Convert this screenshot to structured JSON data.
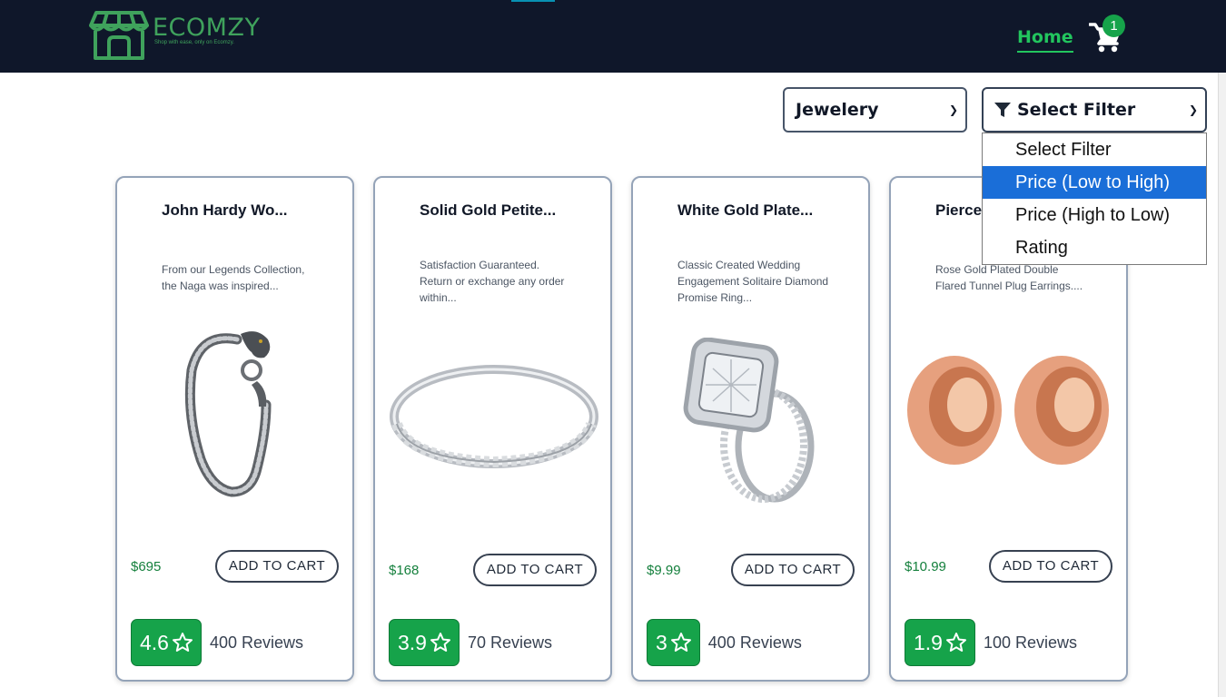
{
  "brand": {
    "name": "ECOMZY",
    "tagline": "Shop with ease, only on Ecomzy."
  },
  "nav": {
    "home_label": "Home",
    "cart_count": "1"
  },
  "filters": {
    "category_value": "Jewelery",
    "sort_value": "Select Filter",
    "sort_options": [
      "Select Filter",
      "Price (Low to High)",
      "Price (High to Low)",
      "Rating"
    ],
    "highlighted_option": "Price (Low to High)"
  },
  "products": [
    {
      "title": "John Hardy Wo...",
      "description": "From our Legends Collection, the Naga was inspired...",
      "image": "chain-bracelet",
      "price": "$695",
      "add_label": "ADD TO CART",
      "rating": "4.6",
      "reviews": "400 Reviews"
    },
    {
      "title": "Solid Gold Petite...",
      "description": "Satisfaction Guaranteed. Return or exchange any order within...",
      "image": "eternity-ring",
      "price": "$168",
      "add_label": "ADD TO CART",
      "rating": "3.9",
      "reviews": "70 Reviews"
    },
    {
      "title": "White Gold Plate...",
      "description": "Classic Created Wedding Engagement Solitaire Diamond Promise Ring...",
      "image": "halo-ring-set",
      "price": "$9.99",
      "add_label": "ADD TO CART",
      "rating": "3",
      "reviews": "400 Reviews"
    },
    {
      "title": "Pierced Owl Ros...",
      "description": "Rose Gold Plated Double Flared Tunnel Plug Earrings....",
      "image": "tunnel-plugs",
      "price": "$10.99",
      "add_label": "ADD TO CART",
      "rating": "1.9",
      "reviews": "100 Reviews"
    }
  ],
  "colors": {
    "navbar": "#0f172a",
    "accent_green": "#16a34a",
    "dropdown_highlight": "#1a6ed8"
  }
}
